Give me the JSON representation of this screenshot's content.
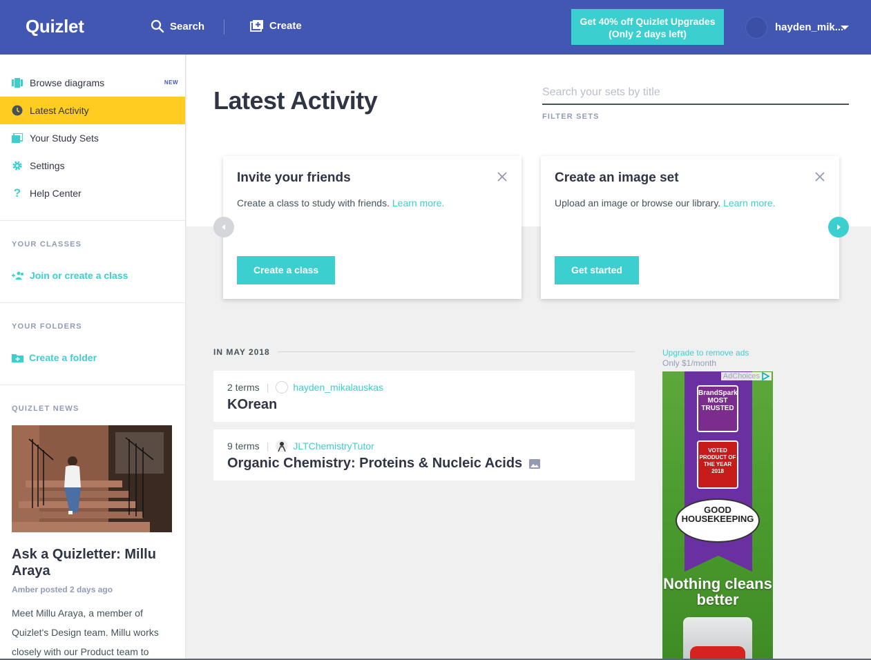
{
  "header": {
    "logo": "Quizlet",
    "search_label": "Search",
    "create_label": "Create",
    "upgrade_line1": "Get 40% off Quizlet Upgrades",
    "upgrade_line2": "(Only 2 days left)",
    "username": "hayden_mik..."
  },
  "sidebar": {
    "items": [
      {
        "label": "Browse diagrams",
        "badge": "NEW",
        "icon": "diagram-icon"
      },
      {
        "label": "Latest Activity",
        "icon": "clock-icon",
        "active": true
      },
      {
        "label": "Your Study Sets",
        "icon": "sets-icon"
      },
      {
        "label": "Settings",
        "icon": "gear-icon"
      },
      {
        "label": "Help Center",
        "icon": "question-icon"
      }
    ],
    "classes_heading": "YOUR CLASSES",
    "join_class": "Join or create a class",
    "folders_heading": "YOUR FOLDERS",
    "create_folder": "Create a folder",
    "news_heading": "QUIZLET NEWS",
    "news_title": "Ask a Quizletter: Millu Araya",
    "news_meta": "Amber posted 2 days ago",
    "news_body": "Meet Millu Araya, a member of Quizlet's Design team. Millu works closely with our Product team to"
  },
  "main": {
    "title": "Latest Activity",
    "search_placeholder": "Search your sets by title",
    "filter_label": "FILTER SETS",
    "cards": [
      {
        "title": "Invite your friends",
        "text": "Create a class to study with friends.",
        "link": "Learn more.",
        "button": "Create a class"
      },
      {
        "title": "Create an image set",
        "text": "Upload an image or browse our library.",
        "link": "Learn more.",
        "button": "Get started"
      }
    ],
    "section_label": "IN MAY 2018",
    "sets": [
      {
        "terms": "2 terms",
        "author": "hayden_mikalauskas",
        "title": "KOrean",
        "has_image": false
      },
      {
        "terms": "9 terms",
        "author": "JLTChemistryTutor",
        "title": "Organic Chemistry: Proteins & Nucleic Acids",
        "has_image": true
      }
    ]
  },
  "ad": {
    "upgrade": "Upgrade to remove ads",
    "price": "Only $1/month",
    "adchoices": "AdChoices",
    "tagline": "Nothing cleans better",
    "seal1": "BrandSpark MOST TRUSTED",
    "seal2": "VOTED PRODUCT OF THE YEAR 2018",
    "seal3": "GOOD HOUSEKEEPING"
  },
  "colors": {
    "header": "#4257b2",
    "accent": "#3ccfcf",
    "active": "#ffcd1f"
  }
}
